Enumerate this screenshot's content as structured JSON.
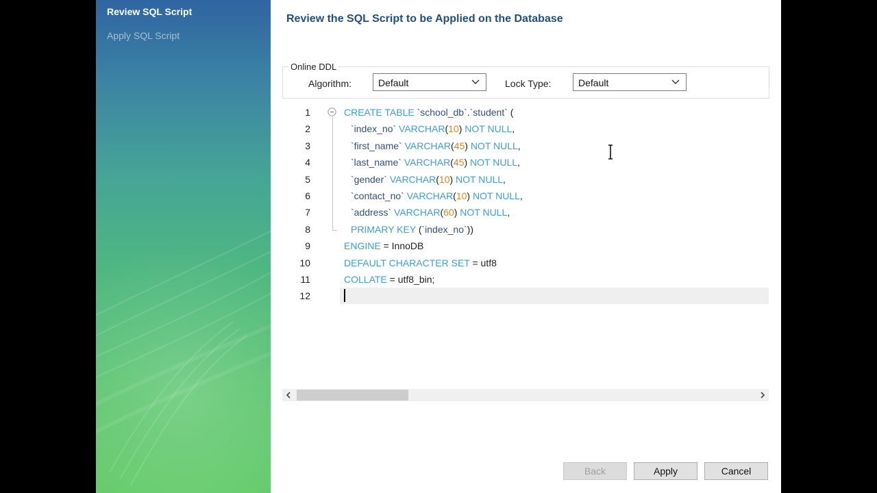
{
  "sidebar": {
    "steps": [
      {
        "label": "Review SQL Script",
        "active": true
      },
      {
        "label": "Apply SQL Script",
        "active": false
      }
    ]
  },
  "main": {
    "title": "Review the SQL Script to be Applied on the Database",
    "online_ddl": {
      "legend": "Online DDL",
      "algorithm_label": "Algorithm:",
      "algorithm_value": "Default",
      "lock_type_label": "Lock Type:",
      "lock_type_value": "Default"
    },
    "editor": {
      "line_numbers": [
        "1",
        "2",
        "3",
        "4",
        "5",
        "6",
        "7",
        "8",
        "9",
        "10",
        "11",
        "12"
      ],
      "cursor_line": 12
    }
  },
  "buttons": {
    "back": "Back",
    "apply": "Apply",
    "cancel": "Cancel"
  },
  "colors": {
    "title": "#1d4f83",
    "keyword": "#3d9ed8",
    "number": "#d68a1a",
    "sidebar_top": "#2f65a2",
    "sidebar_bottom": "#64cb6a"
  },
  "icons": [
    "chevron-down-icon",
    "fold-collapse-icon",
    "text-cursor-icon",
    "scroll-left-icon",
    "scroll-right-icon"
  ]
}
